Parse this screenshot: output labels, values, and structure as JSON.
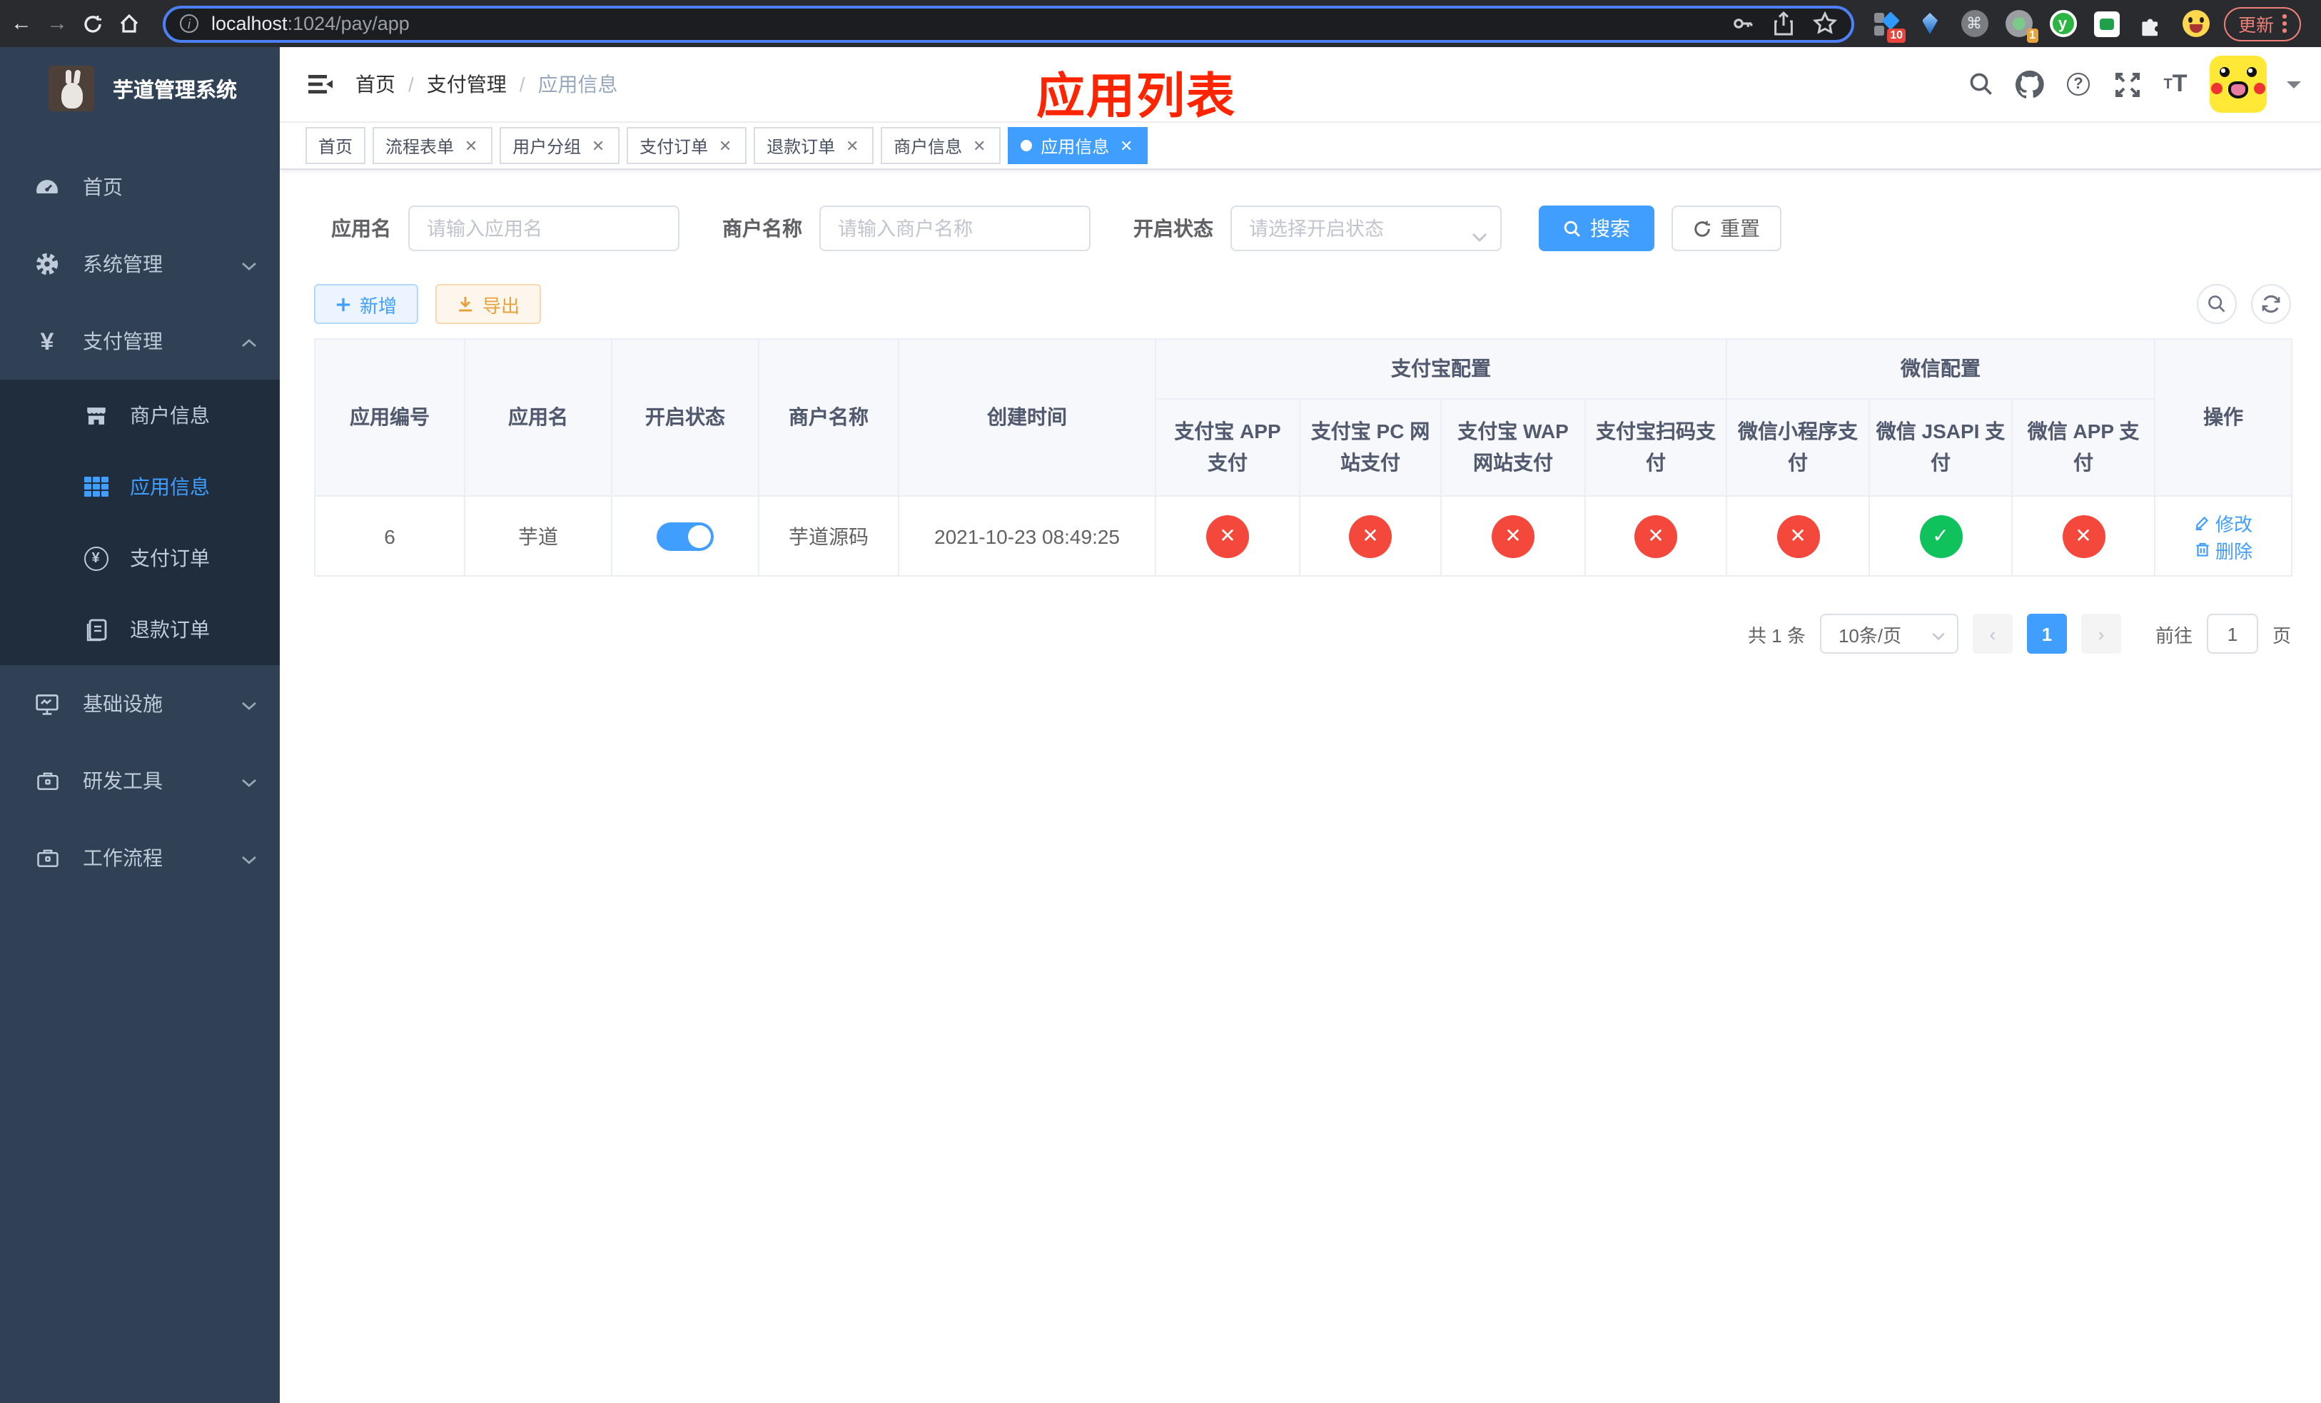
{
  "browser": {
    "url_host": "localhost",
    "url_rest": ":1024/pay/app",
    "update_label": "更新",
    "ext_badge_blue": "10",
    "ext_badge_record": "1"
  },
  "page_title": "应用列表",
  "sidebar": {
    "logo_title": "芋道管理系统",
    "items": [
      {
        "label": "首页"
      },
      {
        "label": "系统管理"
      },
      {
        "label": "支付管理"
      }
    ],
    "submenu": [
      {
        "label": "商户信息"
      },
      {
        "label": "应用信息",
        "active": true
      },
      {
        "label": "支付订单"
      },
      {
        "label": "退款订单"
      }
    ],
    "bottom": [
      {
        "label": "基础设施"
      },
      {
        "label": "研发工具"
      },
      {
        "label": "工作流程"
      }
    ]
  },
  "breadcrumb": [
    "首页",
    "支付管理",
    "应用信息"
  ],
  "tabs": [
    {
      "label": "首页",
      "closable": false
    },
    {
      "label": "流程表单",
      "closable": true
    },
    {
      "label": "用户分组",
      "closable": true
    },
    {
      "label": "支付订单",
      "closable": true
    },
    {
      "label": "退款订单",
      "closable": true
    },
    {
      "label": "商户信息",
      "closable": true
    },
    {
      "label": "应用信息",
      "closable": true,
      "active": true
    }
  ],
  "filters": {
    "app_name_label": "应用名",
    "app_name_placeholder": "请输入应用名",
    "merchant_label": "商户名称",
    "merchant_placeholder": "请输入商户名称",
    "status_label": "开启状态",
    "status_placeholder": "请选择开启状态",
    "search_label": "搜索",
    "reset_label": "重置"
  },
  "toolbar": {
    "add_label": "新增",
    "export_label": "导出"
  },
  "table": {
    "groups": {
      "alipay": "支付宝配置",
      "wechat": "微信配置"
    },
    "headers_row1": [
      "应用编号",
      "应用名",
      "开启状态",
      "商户名称",
      "创建时间"
    ],
    "headers_row2": [
      "支付宝 APP 支付",
      "支付宝 PC 网站支付",
      "支付宝 WAP 网站支付",
      "支付宝扫码支付",
      "微信小程序支付",
      "微信 JSAPI 支付",
      "微信 APP 支付"
    ],
    "action_header": "操作",
    "row": {
      "id": "6",
      "name": "芋道",
      "enabled": true,
      "merchant": "芋道源码",
      "created": "2021-10-23 08:49:25",
      "statuses": [
        "no",
        "no",
        "no",
        "no",
        "no",
        "yes",
        "no"
      ],
      "edit_label": "修改",
      "delete_label": "删除"
    }
  },
  "pagination": {
    "total_label": "共 1 条",
    "page_size": "10条/页",
    "page": "1",
    "goto_label": "前往",
    "goto_value": "1",
    "page_suffix": "页"
  },
  "colors": {
    "accent": "#409eff",
    "danger": "#f5483c",
    "success": "#0fc25c",
    "title_red": "#ff2400"
  }
}
